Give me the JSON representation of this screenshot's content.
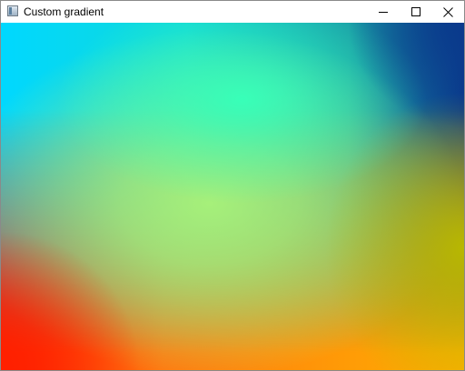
{
  "window": {
    "title": "Custom gradient",
    "icon": "app-window-icon",
    "controls": {
      "minimize_icon": "minimize-icon",
      "maximize_icon": "maximize-icon",
      "close_icon": "close-icon"
    }
  },
  "canvas": {
    "gradient_colors": {
      "top_left": "#00d8ff",
      "top_right": "#0a3a8c",
      "bottom_left": "#ff2000",
      "bottom_right": "#ffb000",
      "center": "#a6f07a",
      "upper_center": "#38ffb8",
      "right_mid": "#b8b800"
    }
  }
}
